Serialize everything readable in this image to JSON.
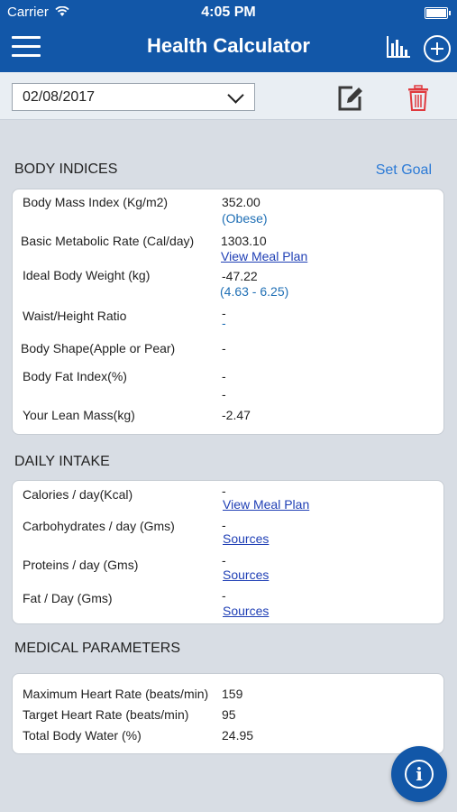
{
  "status_bar": {
    "carrier": "Carrier",
    "time": "4:05 PM"
  },
  "navbar": {
    "title": "Health Calculator",
    "menu_icon": "menu-icon",
    "chart_icon": "chart-icon",
    "add_icon": "plus-circle-icon"
  },
  "toolbar": {
    "date_value": "02/08/2017",
    "edit_icon": "edit-icon",
    "delete_icon": "trash-icon"
  },
  "body_indices": {
    "title": "BODY INDICES",
    "set_goal": "Set Goal",
    "rows": [
      {
        "label": "Body Mass Index (Kg/m2)",
        "value": "352.00",
        "sub": "(Obese)"
      },
      {
        "label": "Basic Metabolic Rate (Cal/day)",
        "value": "1303.10",
        "link": "View Meal Plan"
      },
      {
        "label": "Ideal Body Weight (kg)",
        "value": "-47.22",
        "sub": "(4.63 - 6.25)"
      },
      {
        "label": "Waist/Height Ratio",
        "value": "-",
        "sub": "-"
      },
      {
        "label": "Body Shape(Apple or Pear)",
        "value": "-"
      },
      {
        "label": "Body Fat Index(%)",
        "value": "-",
        "sub": "-"
      },
      {
        "label": "Your Lean Mass(kg)",
        "value": "-2.47"
      }
    ]
  },
  "daily_intake": {
    "title": "DAILY INTAKE",
    "rows": [
      {
        "label": "Calories / day(Kcal)",
        "value": "-",
        "link": "View Meal Plan"
      },
      {
        "label": "Carbohydrates / day (Gms)",
        "value": "-",
        "link": "Sources"
      },
      {
        "label": "Proteins / day (Gms)",
        "value": "-",
        "link": "Sources"
      },
      {
        "label": "Fat / Day (Gms)",
        "value": "-",
        "link": "Sources"
      }
    ]
  },
  "medical_parameters": {
    "title": "MEDICAL PARAMETERS",
    "rows": [
      {
        "label": "Maximum Heart Rate (beats/min)",
        "value": "159"
      },
      {
        "label": "Target Heart Rate (beats/min)",
        "value": "95"
      },
      {
        "label": "Total Body Water (%)",
        "value": "24.95"
      }
    ]
  },
  "fab": {
    "icon": "info-icon",
    "glyph": "i"
  },
  "colors": {
    "primary": "#1257a8",
    "link": "#1f3fb5",
    "accent_link": "#2b7ad6",
    "delete": "#e0393e"
  }
}
